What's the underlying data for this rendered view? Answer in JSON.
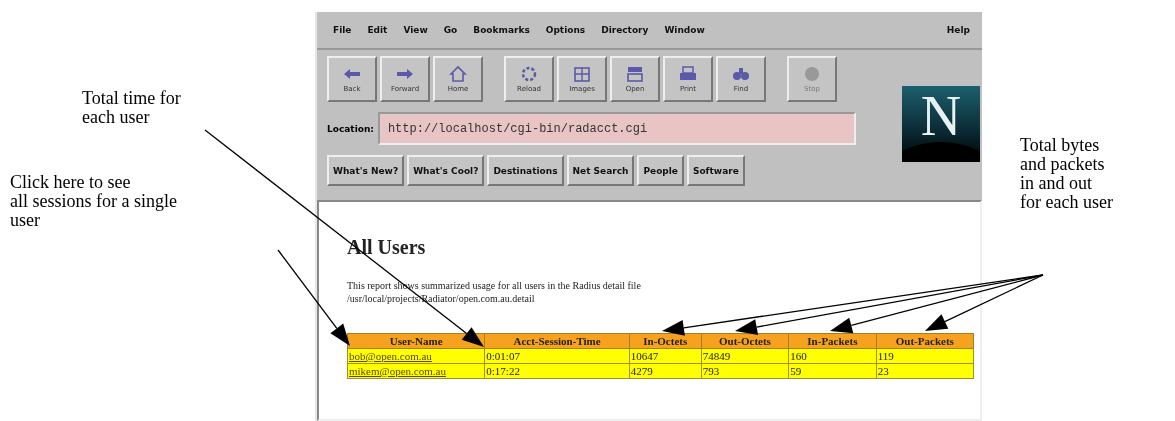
{
  "annotations": [
    {
      "text": "Total time for\neach user"
    },
    {
      "text": "Click here to see\nall sessions for a single\nuser"
    },
    {
      "text": "Total bytes\nand packets\nin and out\nfor each user"
    }
  ],
  "menu": {
    "items": [
      "File",
      "Edit",
      "View",
      "Go",
      "Bookmarks",
      "Options",
      "Directory",
      "Window"
    ],
    "help": "Help"
  },
  "toolbar": [
    {
      "label": "Back",
      "disabled": false
    },
    {
      "label": "Forward",
      "disabled": false
    },
    {
      "label": "Home",
      "disabled": false
    },
    {
      "label": "Reload",
      "disabled": false
    },
    {
      "label": "Images",
      "disabled": false
    },
    {
      "label": "Open",
      "disabled": false
    },
    {
      "label": "Print",
      "disabled": false
    },
    {
      "label": "Find",
      "disabled": false
    },
    {
      "label": "Stop",
      "disabled": true
    }
  ],
  "logo": {
    "text": "N"
  },
  "location": {
    "label": "Location:",
    "value": "http://localhost/cgi-bin/radacct.cgi"
  },
  "directory_buttons": [
    "What's New?",
    "What's Cool?",
    "Destinations",
    "Net Search",
    "People",
    "Software"
  ],
  "page": {
    "heading": "All Users",
    "description": "This report shows summarized usage for all users in the Radius detail file /usr/local/projects/Radiator/open.com.au.detail",
    "table": {
      "columns": [
        "User-Name",
        "Acct-Session-Time",
        "In-Octets",
        "Out-Octets",
        "In-Packets",
        "Out-Packets"
      ],
      "rows": [
        [
          "bob@open.com.au",
          "0:01:07",
          "10647",
          "74849",
          "160",
          "119"
        ],
        [
          "mikem@open.com.au",
          "0:17:22",
          "4279",
          "793",
          "59",
          "23"
        ]
      ]
    }
  }
}
